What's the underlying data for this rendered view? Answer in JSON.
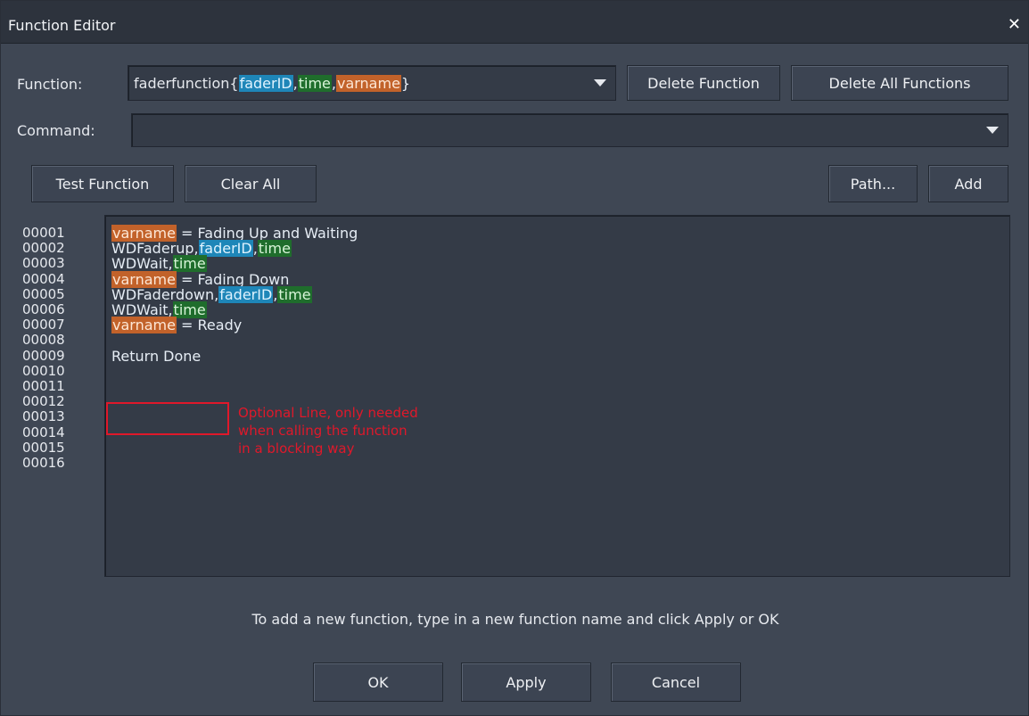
{
  "window": {
    "title": "Function Editor",
    "close_glyph": "✕"
  },
  "function_row": {
    "label": "Function:",
    "name": "faderfunction{",
    "params": [
      {
        "text": "faderID",
        "kind": "faderID"
      },
      {
        "text": ",",
        "kind": "plain"
      },
      {
        "text": "time",
        "kind": "time"
      },
      {
        "text": ",",
        "kind": "plain"
      },
      {
        "text": "varname",
        "kind": "varname"
      },
      {
        "text": "}",
        "kind": "plain"
      }
    ],
    "delete_function": "Delete Function",
    "delete_all_functions": "Delete All Functions"
  },
  "command_row": {
    "label": "Command:",
    "value": ""
  },
  "actions": {
    "test_function": "Test Function",
    "clear_all": "Clear All",
    "path": "Path...",
    "add": "Add"
  },
  "editor": {
    "line_numbers": [
      "00001",
      "00002",
      "00003",
      "00004",
      "00005",
      "00006",
      "00007",
      "00008",
      "00009",
      "00010",
      "00011",
      "00012",
      "00013",
      "00014",
      "00015",
      "00016"
    ],
    "lines": [
      [
        {
          "t": "varname",
          "k": "varname"
        },
        {
          "t": " = Fading Up and Waiting",
          "k": "plain"
        }
      ],
      [
        {
          "t": "WDFaderup,",
          "k": "plain"
        },
        {
          "t": "faderID",
          "k": "faderID"
        },
        {
          "t": ",",
          "k": "plain"
        },
        {
          "t": "time",
          "k": "time"
        }
      ],
      [
        {
          "t": "WDWait,",
          "k": "plain"
        },
        {
          "t": "time",
          "k": "time"
        }
      ],
      [
        {
          "t": "varname",
          "k": "varname"
        },
        {
          "t": " = Fading Down",
          "k": "plain"
        }
      ],
      [
        {
          "t": "WDFaderdown,",
          "k": "plain"
        },
        {
          "t": "faderID",
          "k": "faderID"
        },
        {
          "t": ",",
          "k": "plain"
        },
        {
          "t": "time",
          "k": "time"
        }
      ],
      [
        {
          "t": "WDWait,",
          "k": "plain"
        },
        {
          "t": "time",
          "k": "time"
        }
      ],
      [
        {
          "t": "varname",
          "k": "varname"
        },
        {
          "t": " = Ready",
          "k": "plain"
        }
      ],
      [],
      [
        {
          "t": "Return Done",
          "k": "plain"
        }
      ]
    ],
    "annotation": [
      "Optional Line, only needed",
      "when calling the function",
      "in a blocking way"
    ]
  },
  "hint": "To add a new function, type in a new function name and click Apply or OK",
  "footer": {
    "ok": "OK",
    "apply": "Apply",
    "cancel": "Cancel"
  },
  "colors": {
    "varname": "#c2622a",
    "faderID": "#1e86b8",
    "time": "#1f6d2c",
    "annotation": "#e0182a"
  }
}
